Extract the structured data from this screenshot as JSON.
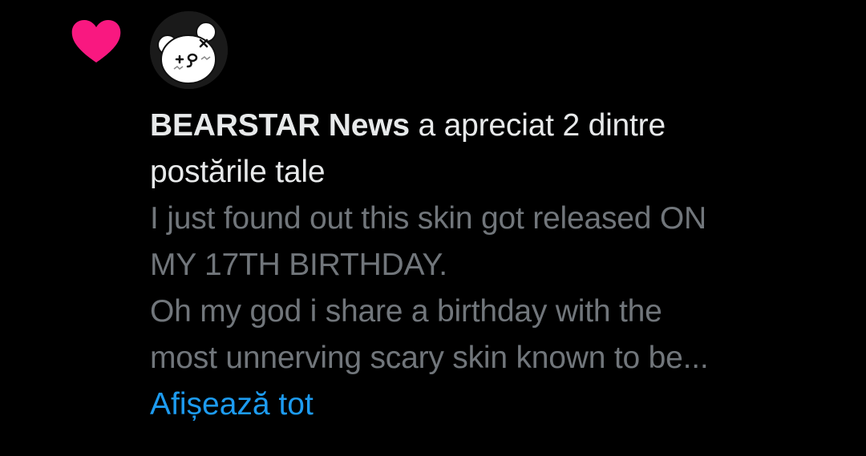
{
  "notification": {
    "icon": "heart-icon",
    "icon_color": "#f91880",
    "avatar": "bear-avatar",
    "author": "BEARSTAR News",
    "action_line1": " a apreciat 2 dintre",
    "action_line2": "postările tale",
    "post_lines": [
      "I just found out this skin got released ON",
      "MY 17TH BIRTHDAY.",
      "Oh my god i share a birthday with the",
      "most unnerving scary skin known to be..."
    ],
    "show_more": "Afișează tot"
  },
  "colors": {
    "background": "#000000",
    "primary_text": "#e7e9ea",
    "secondary_text": "#71767b",
    "link": "#1d9bf0",
    "like": "#f91880"
  }
}
